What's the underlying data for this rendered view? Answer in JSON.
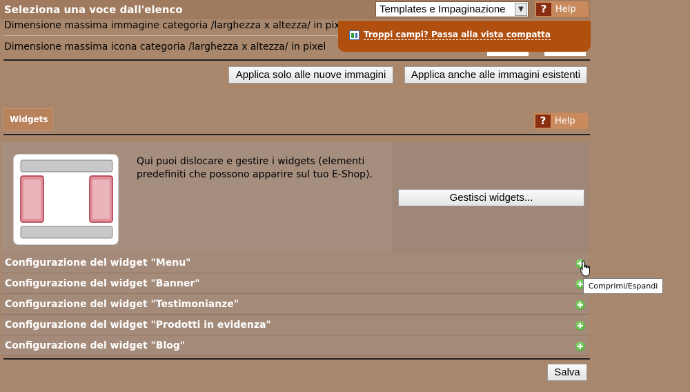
{
  "header": {
    "title": "Seleziona una voce dall'elenco"
  },
  "select": {
    "value": "Templates e Impaginazione"
  },
  "help": {
    "q": "?",
    "label": "Help"
  },
  "rows": [
    {
      "label": "Dimensione massima immagine categoria /larghezza x altezza/ in pixel"
    },
    {
      "label": "Dimensione massima icona categoria /larghezza x altezza/ in pixel"
    }
  ],
  "buttons": {
    "apply_new": "Applica solo alle nuove immagini",
    "apply_existing": "Applica anche alle immagini esistenti",
    "manage_widgets": "Gestisci widgets...",
    "save": "Salva"
  },
  "widgets": {
    "tab_label": "Widgets",
    "description": "Qui puoi dislocare e gestire i widgets (elementi predefiniti che possono apparire sul tuo E-Shop)."
  },
  "accordion": [
    {
      "title": "Configurazione del widget \"Menu\""
    },
    {
      "title": "Configurazione del widget \"Banner\""
    },
    {
      "title": "Configurazione del widget \"Testimonianze\""
    },
    {
      "title": "Configurazione del widget \"Prodotti in evidenza\""
    },
    {
      "title": "Configurazione del widget \"Blog\""
    }
  ],
  "popup": {
    "link": "Troppi campi? Passa alla vista compatta"
  },
  "tooltip": "Comprimi/Espandi",
  "colors": {
    "background": "#a8876c",
    "popup": "#b04f0e",
    "help_icon": "#8a2e12",
    "expand_icon": "#3a9a26"
  }
}
